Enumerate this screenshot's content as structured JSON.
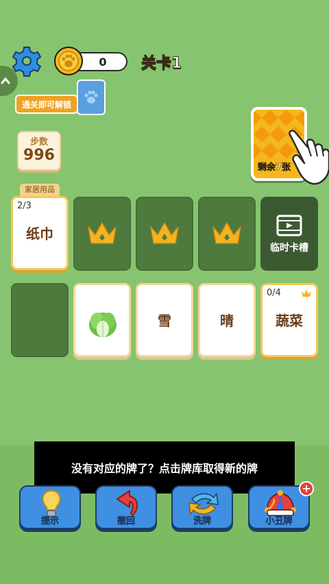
{
  "header": {
    "coins": "0",
    "level_title": "关卡1"
  },
  "unlock": {
    "label": "通关即可解锁"
  },
  "steps": {
    "label": "步数",
    "value": "996"
  },
  "deck": {
    "remaining_label": "剩余7张"
  },
  "category_label": "家居用品",
  "row1": [
    {
      "count": "2/3",
      "text": "纸巾"
    },
    {
      "icon": "crown-icon"
    },
    {
      "icon": "crown-icon"
    },
    {
      "icon": "crown-icon"
    },
    {
      "label": "临时卡槽",
      "icon": "video-card-icon"
    }
  ],
  "row2": [
    {
      "empty": true
    },
    {
      "icon": "cabbage-icon"
    },
    {
      "text": "雪"
    },
    {
      "text": "晴"
    },
    {
      "count": "0/4",
      "text": "蔬菜"
    }
  ],
  "toast": "没有对应的牌了？点击牌库取得新的牌",
  "tools": [
    {
      "label": "提示",
      "icon": "lightbulb-icon"
    },
    {
      "label": "撤回",
      "icon": "undo-arrow-icon"
    },
    {
      "label": "洗牌",
      "icon": "shuffle-arrows-icon"
    },
    {
      "label": "小丑牌",
      "icon": "jester-hat-icon",
      "badge": "+"
    }
  ],
  "colors": {
    "background": "#87c46f",
    "card_border": "#f4c85a",
    "slot_dark": "#4f7a3e",
    "tool_blue": "#3f8fe2",
    "accent_orange": "#f0a224"
  }
}
